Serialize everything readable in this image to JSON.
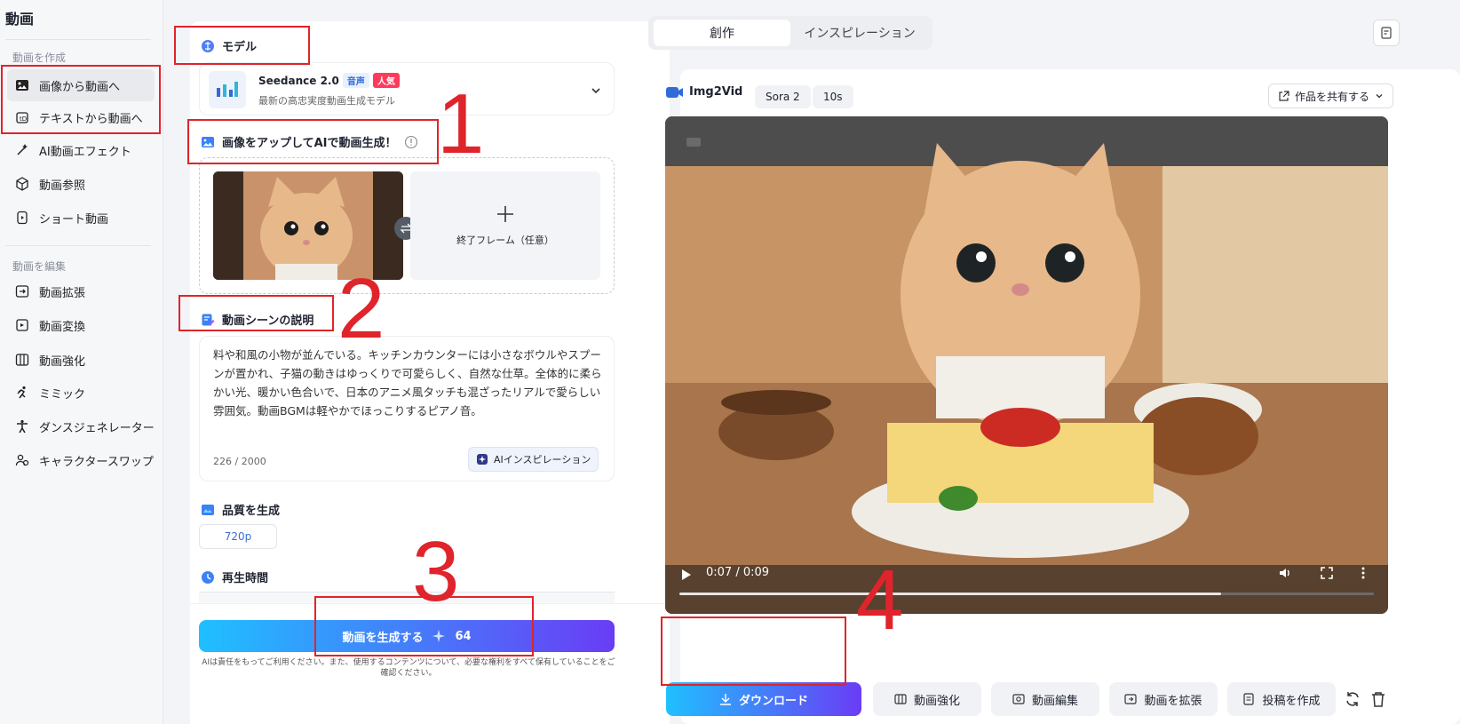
{
  "sidebar": {
    "title": "動画",
    "section_create": "動画を作成",
    "section_edit": "動画を編集",
    "items": [
      {
        "label": "画像から動画へ",
        "icon": "image-video-icon",
        "active": true
      },
      {
        "label": "テキストから動画へ",
        "icon": "text-video-icon"
      },
      {
        "label": "AI動画エフェクト",
        "icon": "magic-wand-icon"
      },
      {
        "label": "動画参照",
        "icon": "cube-icon"
      },
      {
        "label": "ショート動画",
        "icon": "short-video-icon"
      },
      {
        "label": "動画拡張",
        "icon": "expand-icon"
      },
      {
        "label": "動画変換",
        "icon": "convert-icon"
      },
      {
        "label": "動画強化",
        "icon": "enhance-icon"
      },
      {
        "label": "ミミック",
        "icon": "running-icon"
      },
      {
        "label": "ダンスジェネレーター",
        "icon": "dance-icon"
      },
      {
        "label": "キャラクタースワップ",
        "icon": "user-swap-icon"
      }
    ]
  },
  "top_tabs": {
    "create": "創作",
    "inspiration": "インスピレーション"
  },
  "model": {
    "heading": "モデル",
    "name": "Seedance 2.0",
    "badge_audio": "音声",
    "badge_popular": "人気",
    "description": "最新の高忠実度動画生成モデル"
  },
  "upload": {
    "heading": "画像をアップしてAIで動画生成！",
    "end_frame_label": "終了フレーム（任意）"
  },
  "scene": {
    "heading": "動画シーンの説明",
    "text": "料や和風の小物が並んでいる。キッチンカウンターには小さなボウルやスプーンが置かれ、子猫の動きはゆっくりで可愛らしく、自然な仕草。全体的に柔らかい光、暖かい色合いで、日本のアニメ風タッチも混ざったリアルで愛らしい雰囲気。動画BGMは軽やかでほっこりするピアノ音。",
    "counter": "226 / 2000",
    "ai_button": "AIインスピレーション"
  },
  "quality": {
    "heading": "品質を生成",
    "value": "720p"
  },
  "duration": {
    "heading": "再生時間"
  },
  "generate": {
    "label": "動画を生成する",
    "credits": "64",
    "disclaimer": "AIは責任をもってご利用ください。また、使用するコンテンツについて、必要な権利をすべて保有していることをご確認ください。"
  },
  "result": {
    "tool": "Img2Vid",
    "model_pill": "Sora 2",
    "duration_pill": "10s",
    "share": "作品を共有する",
    "time": "0:07 / 0:09",
    "progress": 0.78
  },
  "actions": {
    "download": "ダウンロード",
    "enhance": "動画強化",
    "edit": "動画編集",
    "extend": "動画を拡張",
    "post": "投稿を作成"
  },
  "annotations": [
    "1",
    "2",
    "3",
    "4"
  ],
  "colors": {
    "accent_blue": "#1fb6ff",
    "accent_purple": "#6a3cf5",
    "annotation_red": "#e0242b"
  }
}
